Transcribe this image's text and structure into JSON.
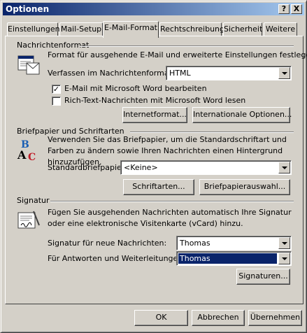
{
  "window": {
    "title": "Optionen",
    "help_label": "?",
    "close_label": "X"
  },
  "tabs": [
    {
      "label": "Einstellungen"
    },
    {
      "label": "Mail-Setup"
    },
    {
      "label": "E-Mail-Format",
      "active": true
    },
    {
      "label": "Rechtschreibung"
    },
    {
      "label": "Sicherheit"
    },
    {
      "label": "Weitere"
    }
  ],
  "message_format": {
    "title": "Nachrichtenformat",
    "description": "Format für ausgehende E-Mail und erweiterte Einstellungen festlegen.",
    "compose_label": "Verfassen im Nachrichtenformat:",
    "compose_value": "HTML",
    "word_edit_label": "E-Mail mit Microsoft Word bearbeiten",
    "word_edit_checked": true,
    "word_read_label": "Rich-Text-Nachrichten mit Microsoft Word lesen",
    "word_read_checked": false,
    "internet_button": "Internetformat...",
    "intl_button": "Internationale Optionen..."
  },
  "stationery": {
    "title": "Briefpapier und Schriftarten",
    "description": "Verwenden Sie das Briefpapier, um die Standardschriftart und Farben zu ändern sowie Ihren Nachrichten einen Hintergrund hinzuzufügen.",
    "default_label": "Standardbriefpapier:",
    "default_value": "<Keine>",
    "fonts_button": "Schriftarten...",
    "picker_button": "Briefpapierauswahl..."
  },
  "signature": {
    "title": "Signatur",
    "description": "Fügen Sie ausgehenden Nachrichten automatisch Ihre Signatur oder eine elektronische Visitenkarte (vCard) hinzu.",
    "new_label": "Signatur für neue Nachrichten:",
    "new_value": "Thomas",
    "reply_label": "Für Antworten und Weiterleitungen:",
    "reply_value": "Thomas",
    "signatures_button": "Signaturen..."
  },
  "footer": {
    "ok": "OK",
    "cancel": "Abbrechen",
    "apply": "Übernehmen"
  }
}
